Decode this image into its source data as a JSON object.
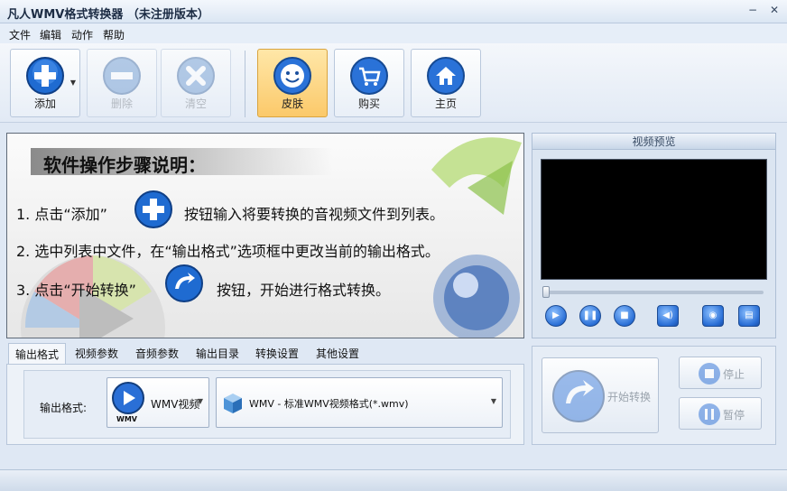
{
  "window": {
    "title": "凡人WMV格式转换器  （未注册版本）",
    "minimize_glyph": "−",
    "close_glyph": "✕"
  },
  "menu": [
    "文件",
    "编辑",
    "动作",
    "帮助"
  ],
  "toolbar": {
    "add": "添加",
    "remove": "删除",
    "clear": "清空",
    "skin": "皮肤",
    "buy": "购买",
    "home": "主页",
    "icons": {
      "add": "plus-icon",
      "remove": "minus-icon",
      "clear": "x-icon",
      "skin": "smiley-icon",
      "buy": "cart-icon",
      "home": "house-icon"
    }
  },
  "guide": {
    "header": "软件操作步骤说明：",
    "step1_a": "1. 点击“添加”",
    "step1_b": "按钮输入将要转换的音视频文件到列表。",
    "step2": "2. 选中列表中文件，在“输出格式”选项框中更改当前的输出格式。",
    "step3_a": "3. 点击“开始转换”",
    "step3_b": "按钮，开始进行格式转换。"
  },
  "preview": {
    "title": "视频预览",
    "seek_position": 0,
    "controls": [
      "play-icon",
      "pause-icon",
      "stop-icon",
      "volume-icon",
      "snapshot-icon",
      "folder-icon"
    ]
  },
  "tabs": [
    "输出格式",
    "视频参数",
    "音频参数",
    "输出目录",
    "转换设置",
    "其他设置"
  ],
  "active_tab": 0,
  "output": {
    "label": "输出格式:",
    "format_value": "WMV视频",
    "format_badge": "WMV",
    "profile_value": "WMV - 标准WMV视频格式(*.wmv)"
  },
  "actions": {
    "start": "开始转换",
    "stop": "停止",
    "pause": "暂停"
  },
  "colors": {
    "accent": "#2a6fd6",
    "skin_active": "#fbc96a"
  }
}
